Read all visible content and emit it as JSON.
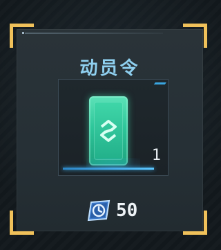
{
  "dialog": {
    "title": "动员令"
  },
  "item": {
    "icon": "mobilization-token-icon",
    "quantity": "1",
    "accent_color": "#3aa6e0",
    "token_color": "#2ec69a"
  },
  "cost": {
    "icon": "clock-ticket-icon",
    "value": "50",
    "bracket_color": "#f0c15a"
  }
}
